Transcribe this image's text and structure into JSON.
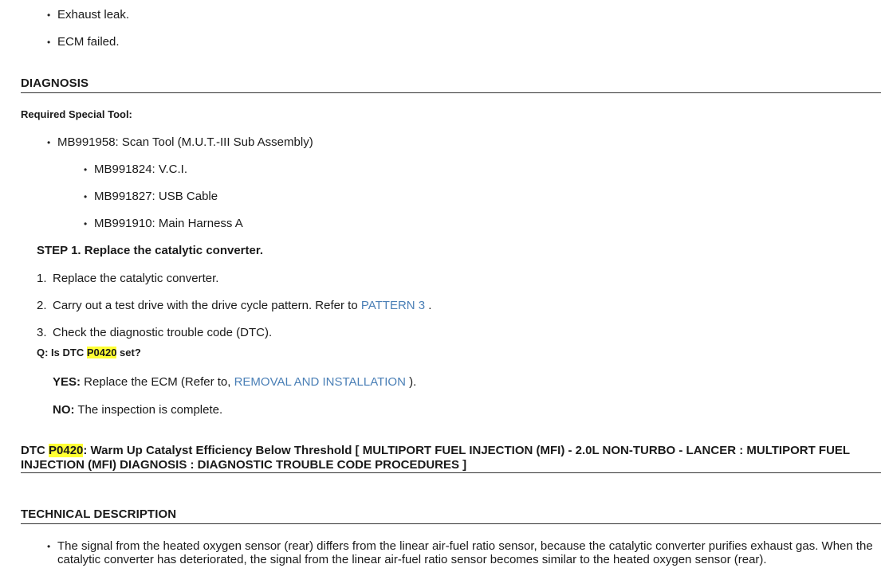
{
  "top_list": [
    "Exhaust leak.",
    "ECM failed."
  ],
  "diagnosis": {
    "heading": "DIAGNOSIS",
    "tool_label": "Required Special Tool:",
    "tool_main": "MB991958: Scan Tool (M.U.T.-III Sub Assembly)",
    "tool_sub": [
      "MB991824: V.C.I.",
      "MB991827: USB Cable",
      "MB991910: Main Harness A"
    ]
  },
  "step1": {
    "title": "STEP 1. Replace the catalytic converter.",
    "items": [
      {
        "num": "1.",
        "text": "Replace the catalytic converter."
      },
      {
        "num": "2.",
        "text": "Carry out a test drive with the drive cycle pattern. Refer to ",
        "link": "PATTERN 3",
        "after": " ."
      },
      {
        "num": "3.",
        "text": "Check the diagnostic trouble code (DTC)."
      }
    ],
    "question_prefix": "Q: Is DTC ",
    "question_code": "P0420",
    "question_suffix": " set?",
    "yes_label": "YES:",
    "yes_text": " Replace the ECM (Refer to, ",
    "yes_link": "REMOVAL AND INSTALLATION",
    "yes_after": " ).",
    "no_label": "NO:",
    "no_text": " The inspection is complete."
  },
  "dtc_section": {
    "prefix": "DTC ",
    "code": "P0420",
    "rest": ": Warm Up Catalyst Efficiency Below Threshold [ MULTIPORT FUEL INJECTION (MFI) - 2.0L NON-TURBO - LANCER : MULTIPORT FUEL INJECTION (MFI) DIAGNOSIS : DIAGNOSTIC TROUBLE CODE PROCEDURES ]"
  },
  "technical": {
    "heading": "TECHNICAL DESCRIPTION",
    "bullet": "The signal from the heated oxygen sensor (rear) differs from the linear air-fuel ratio sensor, because the catalytic converter purifies exhaust gas. When the catalytic converter has deteriorated, the signal from the linear air-fuel ratio sensor becomes similar to the heated oxygen sensor (rear)."
  },
  "colors": {
    "link": "#4a7fb6",
    "highlight": "#ffff33"
  }
}
